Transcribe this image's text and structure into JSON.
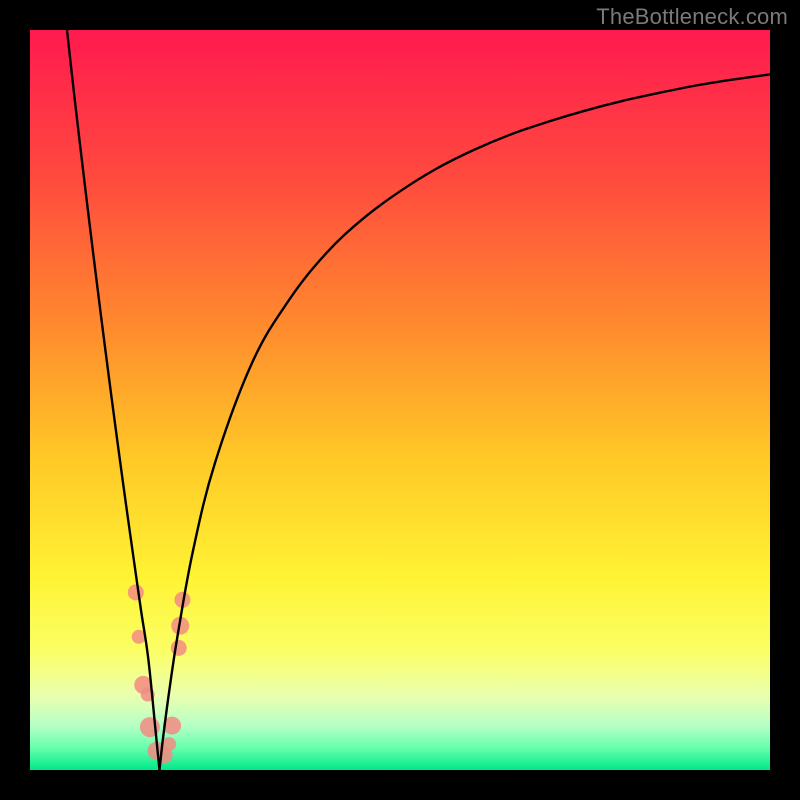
{
  "watermark": "TheBottleneck.com",
  "chart_data": {
    "type": "line",
    "title": "",
    "xlabel": "",
    "ylabel": "",
    "xlim": [
      0,
      100
    ],
    "ylim": [
      0,
      100
    ],
    "grid": false,
    "legend": false,
    "optimal_x": 17.5,
    "background_gradient_stops": [
      {
        "pos": 0.0,
        "color": "#ff1a4f"
      },
      {
        "pos": 0.2,
        "color": "#ff4a3e"
      },
      {
        "pos": 0.4,
        "color": "#ff8a2e"
      },
      {
        "pos": 0.58,
        "color": "#ffc926"
      },
      {
        "pos": 0.74,
        "color": "#fff334"
      },
      {
        "pos": 0.84,
        "color": "#fbff66"
      },
      {
        "pos": 0.9,
        "color": "#eaffb0"
      },
      {
        "pos": 0.94,
        "color": "#b6ffc6"
      },
      {
        "pos": 0.97,
        "color": "#66ffad"
      },
      {
        "pos": 1.0,
        "color": "#00e889"
      }
    ],
    "series": [
      {
        "name": "left-branch",
        "x": [
          5.0,
          6.0,
          7.0,
          8.0,
          9.0,
          10.0,
          11.0,
          12.0,
          13.0,
          14.0,
          15.0,
          16.0,
          17.0,
          17.5
        ],
        "y": [
          100.0,
          91.0,
          82.5,
          74.2,
          66.1,
          58.2,
          50.5,
          43.0,
          35.7,
          28.6,
          21.6,
          14.9,
          5.0,
          0.0
        ]
      },
      {
        "name": "right-branch",
        "x": [
          17.5,
          18.0,
          19.0,
          20.0,
          22.0,
          25.0,
          30.0,
          35.0,
          40.0,
          45.0,
          50.0,
          55.0,
          60.0,
          65.0,
          70.0,
          75.0,
          80.0,
          85.0,
          90.0,
          95.0,
          100.0
        ],
        "y": [
          0.0,
          4.5,
          12.0,
          18.5,
          29.5,
          41.5,
          55.0,
          63.5,
          69.8,
          74.5,
          78.2,
          81.3,
          83.8,
          85.9,
          87.6,
          89.1,
          90.4,
          91.5,
          92.5,
          93.3,
          94.0
        ]
      }
    ],
    "scatter": {
      "name": "data-points",
      "color": "#f28b82",
      "points": [
        {
          "x": 14.3,
          "y": 24.0,
          "r": 8
        },
        {
          "x": 14.7,
          "y": 18.0,
          "r": 7
        },
        {
          "x": 15.3,
          "y": 11.5,
          "r": 9
        },
        {
          "x": 15.9,
          "y": 10.2,
          "r": 7
        },
        {
          "x": 16.2,
          "y": 5.8,
          "r": 10
        },
        {
          "x": 17.1,
          "y": 2.6,
          "r": 9
        },
        {
          "x": 18.2,
          "y": 2.0,
          "r": 8
        },
        {
          "x": 18.8,
          "y": 3.5,
          "r": 7
        },
        {
          "x": 19.2,
          "y": 6.0,
          "r": 9
        },
        {
          "x": 20.1,
          "y": 16.5,
          "r": 8
        },
        {
          "x": 20.3,
          "y": 19.5,
          "r": 9
        },
        {
          "x": 20.6,
          "y": 23.0,
          "r": 8
        }
      ]
    }
  }
}
